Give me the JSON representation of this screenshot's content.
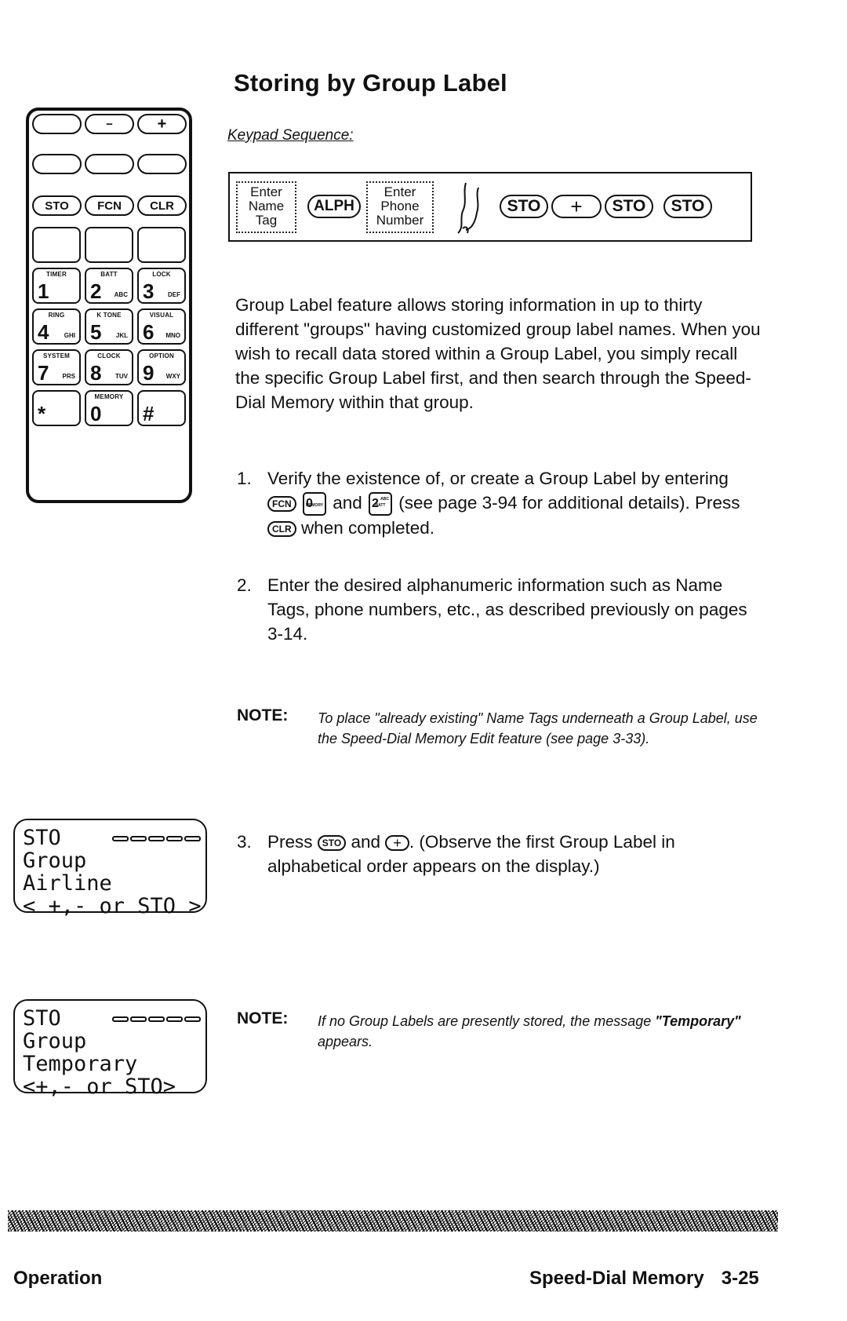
{
  "page": {
    "title": "Storing by Group Label",
    "keypad_sequence_label": "Keypad Sequence:"
  },
  "keypad": {
    "row1": [
      "",
      "−",
      "+"
    ],
    "row2": [
      "",
      "",
      ""
    ],
    "row3": [
      "STO",
      "FCN",
      "CLR"
    ],
    "number_keys": [
      {
        "top": "TIMER",
        "digit": "1",
        "letters": ""
      },
      {
        "top": "BATT",
        "digit": "2",
        "letters": "ABC"
      },
      {
        "top": "LOCK",
        "digit": "3",
        "letters": "DEF"
      },
      {
        "top": "RING",
        "digit": "4",
        "letters": "GHI"
      },
      {
        "top": "K TONE",
        "digit": "5",
        "letters": "JKL"
      },
      {
        "top": "VISUAL",
        "digit": "6",
        "letters": "MNO"
      },
      {
        "top": "SYSTEM",
        "digit": "7",
        "letters": "PRS"
      },
      {
        "top": "CLOCK",
        "digit": "8",
        "letters": "TUV"
      },
      {
        "top": "OPTION",
        "digit": "9",
        "letters": "WXY"
      },
      {
        "top": "",
        "digit": "*",
        "letters": ""
      },
      {
        "top": "MEMORY",
        "digit": "0",
        "letters": ""
      },
      {
        "top": "",
        "digit": "#",
        "letters": ""
      }
    ]
  },
  "sequence": {
    "box1": [
      "Enter",
      "Name",
      "Tag"
    ],
    "alph": "ALPH",
    "box2": [
      "Enter",
      "Phone",
      "Number"
    ],
    "icon": "hand-pointing-icon",
    "keys": [
      "STO",
      "+",
      "STO",
      "STO"
    ]
  },
  "intro": "Group Label feature allows storing information in up to thirty different \"groups\" having customized group label names.  When you wish to recall data stored within a Group Label, you simply recall the specific Group Label first, and then search through the Speed-Dial Memory within that group.",
  "steps": [
    {
      "num": "1.",
      "part1": "Verify the existence of, or create a Group Label by entering",
      "key_fcn": "FCN",
      "key_memory": {
        "top": "MEMORY",
        "digit": "0",
        "letters": ""
      },
      "and": "and",
      "key_batt": {
        "top": "BATT",
        "digit": "2",
        "letters": "ABC"
      },
      "part2": "(see page 3-94 for additional details).  Press",
      "key_clr": "CLR",
      "part3": "when completed."
    },
    {
      "num": "2.",
      "text": "Enter the desired alphanumeric information such as Name Tags, phone numbers, etc., as described previously on pages 3-14."
    },
    {
      "num": "3.",
      "part1": "Press",
      "key_sto": "STO",
      "and": "and",
      "key_plus": "+",
      "part2": ".  (Observe the first Group Label in alphabetical order appears on the display.)"
    }
  ],
  "notes": [
    {
      "label": "NOTE:",
      "text": "To place \"already existing\" Name Tags underneath a Group Label, use the Speed-Dial Memory Edit feature (see page 3-33)."
    },
    {
      "label": "NOTE:",
      "text_pre": "If no Group Labels are presently stored, the message ",
      "emphasis": "\"Temporary\"",
      "text_post": " appears."
    }
  ],
  "displays": [
    {
      "rows": [
        "STO",
        "Group",
        "Airline",
        "< +,- or STO >"
      ],
      "bars": 5
    },
    {
      "rows": [
        "STO",
        "Group",
        "Temporary",
        "<+,- or STO>"
      ],
      "bars": 5
    }
  ],
  "footer": {
    "left": "Operation",
    "right": "Speed-Dial Memory",
    "page_number": "3-25"
  }
}
